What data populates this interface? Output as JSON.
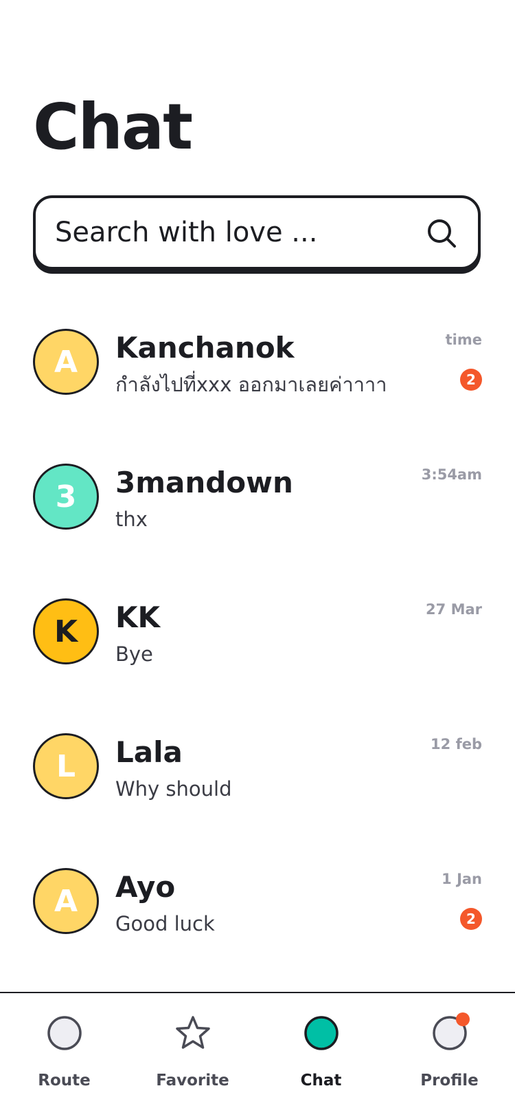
{
  "header": {
    "title": "Chat"
  },
  "search": {
    "placeholder": "Search with love ...",
    "value": ""
  },
  "chats": [
    {
      "initial": "A",
      "avatar_color": "#FFD666",
      "initial_color": "#FFFFFF",
      "name": "Kanchanok",
      "preview": "กำลังไปที่xxx ออกมาเลยค่าาาา",
      "time": "time",
      "unread": "2"
    },
    {
      "initial": "3",
      "avatar_color": "#63E6C5",
      "initial_color": "#FFFFFF",
      "name": "3mandown",
      "preview": "thx",
      "time": "3:54am",
      "unread": ""
    },
    {
      "initial": "K",
      "avatar_color": "#FFBE14",
      "initial_color": "#1C1D22",
      "name": "KK",
      "preview": "Bye",
      "time": "27 Mar",
      "unread": ""
    },
    {
      "initial": "L",
      "avatar_color": "#FFD666",
      "initial_color": "#FFFFFF",
      "name": "Lala",
      "preview": "Why should",
      "time": "12 feb",
      "unread": ""
    },
    {
      "initial": "A",
      "avatar_color": "#FFD666",
      "initial_color": "#FFFFFF",
      "name": "Ayo",
      "preview": "Good luck",
      "time": "1 Jan",
      "unread": "2"
    }
  ],
  "tabs": [
    {
      "label": "Route",
      "icon": "circle-icon",
      "active": false
    },
    {
      "label": "Favorite",
      "icon": "star-icon",
      "active": false
    },
    {
      "label": "Chat",
      "icon": "chat-icon",
      "active": true
    },
    {
      "label": "Profile",
      "icon": "profile-icon",
      "active": false,
      "notification": true
    }
  ],
  "colors": {
    "text": "#1C1D22",
    "muted": "#9A9BA6",
    "badge": "#F4582B",
    "active_tab": "#00BFA5",
    "inactive_tab_fill": "#EEEEF3"
  }
}
